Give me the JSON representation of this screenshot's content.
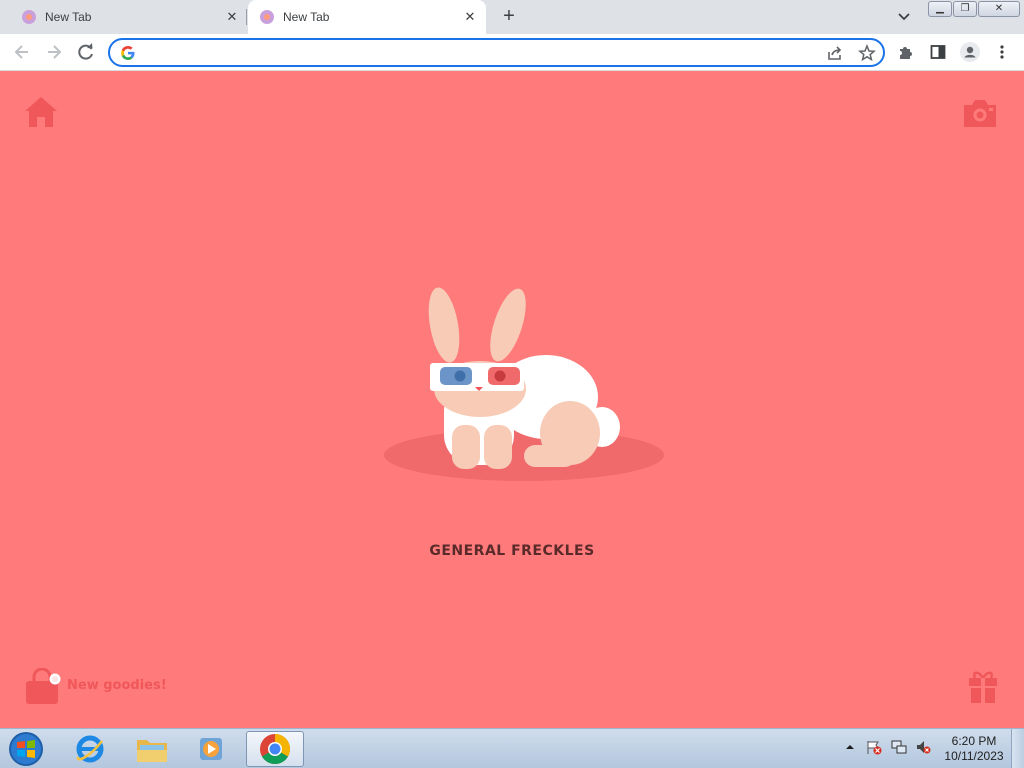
{
  "browser": {
    "tabs": [
      {
        "title": "New Tab",
        "active": false
      },
      {
        "title": "New Tab",
        "active": true
      }
    ],
    "omnibox": {
      "value": "",
      "placeholder": ""
    }
  },
  "page": {
    "character_name": "GENERAL FRECKLES",
    "goodies_label": "New goodies!",
    "background_color": "#ff7b7b",
    "accent_color": "#f0575b"
  },
  "taskbar": {
    "time": "6:20 PM",
    "date": "10/11/2023",
    "apps": [
      "internet-explorer",
      "file-explorer",
      "media-player",
      "chrome"
    ]
  }
}
